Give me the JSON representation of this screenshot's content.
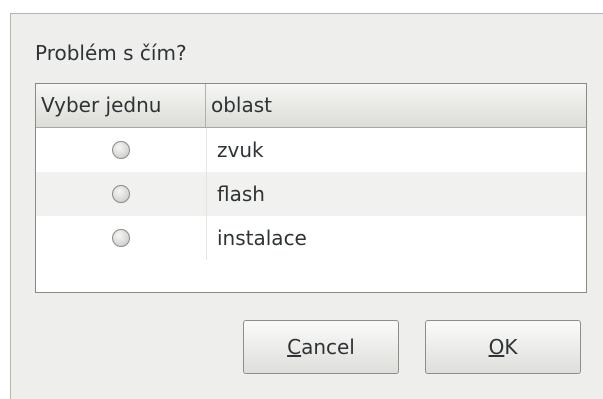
{
  "dialog": {
    "prompt": "Problém s čím?",
    "columns": [
      "Vyber jednu",
      "oblast"
    ],
    "rows": [
      {
        "label": "zvuk",
        "selected": false
      },
      {
        "label": "flash",
        "selected": false
      },
      {
        "label": "instalace",
        "selected": false
      }
    ],
    "buttons": {
      "cancel": {
        "mnemonic": "C",
        "rest": "ancel"
      },
      "ok": {
        "mnemonic": "O",
        "rest": "K"
      }
    }
  }
}
